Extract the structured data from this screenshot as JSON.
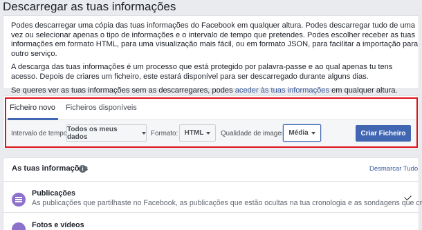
{
  "page": {
    "title": "Descarregar as tuas informações"
  },
  "intro": {
    "p1": "Podes descarregar uma cópia das tuas informações do Facebook em qualquer altura. Podes descarregar tudo de uma vez ou selecionar apenas o tipo de informações e o intervalo de tempo que pretendes. Podes escolher receber as tuas informações em formato HTML, para uma visualização mais fácil, ou em formato JSON, para facilitar a importação para outro serviço.",
    "p2": "A descarga das tuas informações é um processo que está protegido por palavra-passe e ao qual apenas tu tens acesso. Depois de criares um ficheiro, este estará disponível para ser descarregado durante alguns dias.",
    "p3_before": "Se queres ver as tuas informações sem as descarregares, podes ",
    "p3_link": "aceder às tuas informações",
    "p3_after": " em qualquer altura."
  },
  "tabs": {
    "new_file": "Ficheiro novo",
    "available_files": "Ficheiros disponíveis"
  },
  "filters": {
    "date_range_label": "Intervalo de tempo:",
    "date_range_value": "Todos os meus dados",
    "format_label": "Formato:",
    "format_value": "HTML",
    "media_quality_label": "Qualidade de imagem:",
    "media_quality_value": "Média",
    "create_button": "Criar Ficheiro"
  },
  "info": {
    "title": "As tuas informações",
    "info_icon": "i",
    "deselect_all": "Desmarcar Tudo",
    "items": [
      {
        "title": "Publicações",
        "description": "As publicações que partilhaste no Facebook, as publicações que estão ocultas na tua cronologia e as sondagens que criaste",
        "icon": "posts-icon"
      },
      {
        "title": "Fotos e vídeos",
        "description": "",
        "icon": "photos-icon"
      }
    ]
  },
  "colors": {
    "accent": "#4267b2",
    "highlight": "#e0101a",
    "link": "#385898",
    "posts_icon": "#8c72cb"
  }
}
